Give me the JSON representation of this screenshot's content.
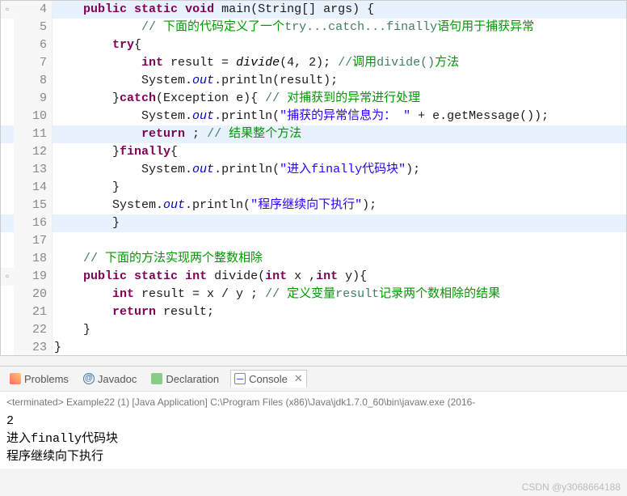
{
  "watermark": "CSDN @y3068664188",
  "tabs": {
    "problems": "Problems",
    "javadoc": "Javadoc",
    "declaration": "Declaration",
    "console": "Console"
  },
  "console": {
    "header": "<terminated> Example22 (1) [Java Application] C:\\Program Files (x86)\\Java\\jdk1.7.0_60\\bin\\javaw.exe (2016-",
    "out1": "2",
    "out2": "进入finally代码块",
    "out3": "程序继续向下执行"
  },
  "lines": {
    "l4": {
      "n": "4",
      "hl": true,
      "mk": "▫",
      "indent": "    ",
      "seg": [
        {
          "c": "kw",
          "t": "public"
        },
        {
          "t": " "
        },
        {
          "c": "kw",
          "t": "static"
        },
        {
          "t": " "
        },
        {
          "c": "kw",
          "t": "void"
        },
        {
          "t": " main(String[] args) {"
        }
      ]
    },
    "l5": {
      "n": "5",
      "hl": false,
      "mk": "",
      "indent": "            ",
      "seg": [
        {
          "c": "cmt",
          "t": "// "
        },
        {
          "c": "cmt-cn",
          "t": "下面的代码定义了一个"
        },
        {
          "c": "cmt",
          "t": "try...catch...finally"
        },
        {
          "c": "cmt-cn",
          "t": "语句用于捕获异常"
        }
      ]
    },
    "l6": {
      "n": "6",
      "hl": false,
      "mk": "",
      "indent": "        ",
      "seg": [
        {
          "c": "kw",
          "t": "try"
        },
        {
          "t": "{"
        }
      ]
    },
    "l7": {
      "n": "7",
      "hl": false,
      "mk": "",
      "indent": "            ",
      "seg": [
        {
          "c": "kw",
          "t": "int"
        },
        {
          "t": " result = "
        },
        {
          "c": "meth-it",
          "t": "divide"
        },
        {
          "t": "(4, 2); "
        },
        {
          "c": "cmt",
          "t": "//"
        },
        {
          "c": "cmt-cn",
          "t": "调用"
        },
        {
          "c": "cmt",
          "t": "divide()"
        },
        {
          "c": "cmt-cn",
          "t": "方法"
        }
      ]
    },
    "l8": {
      "n": "8",
      "hl": false,
      "mk": "",
      "indent": "            ",
      "seg": [
        {
          "t": "System."
        },
        {
          "c": "fld",
          "t": "out"
        },
        {
          "t": ".println(result);"
        }
      ]
    },
    "l9": {
      "n": "9",
      "hl": false,
      "mk": "",
      "indent": "        ",
      "seg": [
        {
          "t": "}"
        },
        {
          "c": "kw",
          "t": "catch"
        },
        {
          "t": "(Exception e){ "
        },
        {
          "c": "cmt",
          "t": "// "
        },
        {
          "c": "cmt-cn",
          "t": "对捕获到的异常进行处理"
        }
      ]
    },
    "l10": {
      "n": "10",
      "hl": false,
      "mk": "",
      "indent": "            ",
      "seg": [
        {
          "t": "System."
        },
        {
          "c": "fld",
          "t": "out"
        },
        {
          "t": ".println("
        },
        {
          "c": "str",
          "t": "\"捕获的异常信息为： \""
        },
        {
          "t": " + e.getMessage());"
        }
      ]
    },
    "l11": {
      "n": "11",
      "hl": true,
      "mk": "",
      "indent": "            ",
      "seg": [
        {
          "c": "kw",
          "t": "return"
        },
        {
          "t": " ; "
        },
        {
          "c": "cmt",
          "t": "// "
        },
        {
          "c": "cmt-cn",
          "t": "结果整个方法"
        }
      ]
    },
    "l12": {
      "n": "12",
      "hl": false,
      "mk": "",
      "indent": "        ",
      "seg": [
        {
          "t": "}"
        },
        {
          "c": "kw",
          "t": "finally"
        },
        {
          "t": "{"
        }
      ]
    },
    "l13": {
      "n": "13",
      "hl": false,
      "mk": "",
      "indent": "            ",
      "seg": [
        {
          "t": "System."
        },
        {
          "c": "fld",
          "t": "out"
        },
        {
          "t": ".println("
        },
        {
          "c": "str",
          "t": "\"进入finally代码块\""
        },
        {
          "t": ");"
        }
      ]
    },
    "l14": {
      "n": "14",
      "hl": false,
      "mk": "",
      "indent": "        ",
      "seg": [
        {
          "t": "}"
        }
      ]
    },
    "l15": {
      "n": "15",
      "hl": false,
      "mk": "",
      "indent": "        ",
      "seg": [
        {
          "t": "System."
        },
        {
          "c": "fld",
          "t": "out"
        },
        {
          "t": ".println("
        },
        {
          "c": "str",
          "t": "\"程序继续向下执行\""
        },
        {
          "t": ");"
        }
      ]
    },
    "l16": {
      "n": "16",
      "hl": true,
      "mk": "",
      "indent": "        ",
      "seg": [
        {
          "t": "}"
        }
      ]
    },
    "l17": {
      "n": "17",
      "hl": false,
      "mk": "",
      "indent": "",
      "seg": []
    },
    "l18": {
      "n": "18",
      "hl": false,
      "mk": "",
      "indent": "    ",
      "seg": [
        {
          "c": "cmt",
          "t": "// "
        },
        {
          "c": "cmt-cn",
          "t": "下面的方法实现两个整数相除"
        }
      ]
    },
    "l19": {
      "n": "19",
      "hl": false,
      "mk": "▫",
      "indent": "    ",
      "seg": [
        {
          "c": "kw",
          "t": "public"
        },
        {
          "t": " "
        },
        {
          "c": "kw",
          "t": "static"
        },
        {
          "t": " "
        },
        {
          "c": "kw",
          "t": "int"
        },
        {
          "t": " divide("
        },
        {
          "c": "kw",
          "t": "int"
        },
        {
          "t": " x ,"
        },
        {
          "c": "kw",
          "t": "int"
        },
        {
          "t": " y){"
        }
      ]
    },
    "l20": {
      "n": "20",
      "hl": false,
      "mk": "",
      "indent": "        ",
      "seg": [
        {
          "c": "kw",
          "t": "int"
        },
        {
          "t": " result = x / y ; "
        },
        {
          "c": "cmt",
          "t": "// "
        },
        {
          "c": "cmt-cn",
          "t": "定义变量"
        },
        {
          "c": "cmt",
          "t": "result"
        },
        {
          "c": "cmt-cn",
          "t": "记录两个数相除的结果"
        }
      ]
    },
    "l21": {
      "n": "21",
      "hl": false,
      "mk": "",
      "indent": "        ",
      "seg": [
        {
          "c": "kw",
          "t": "return"
        },
        {
          "t": " result;"
        }
      ]
    },
    "l22": {
      "n": "22",
      "hl": false,
      "mk": "",
      "indent": "    ",
      "seg": [
        {
          "t": "}"
        }
      ]
    },
    "l23": {
      "n": "23",
      "hl": false,
      "mk": "",
      "indent": "",
      "seg": [
        {
          "t": "}"
        }
      ]
    }
  },
  "lineOrder": [
    "l4",
    "l5",
    "l6",
    "l7",
    "l8",
    "l9",
    "l10",
    "l11",
    "l12",
    "l13",
    "l14",
    "l15",
    "l16",
    "l17",
    "l18",
    "l19",
    "l20",
    "l21",
    "l22",
    "l23"
  ]
}
